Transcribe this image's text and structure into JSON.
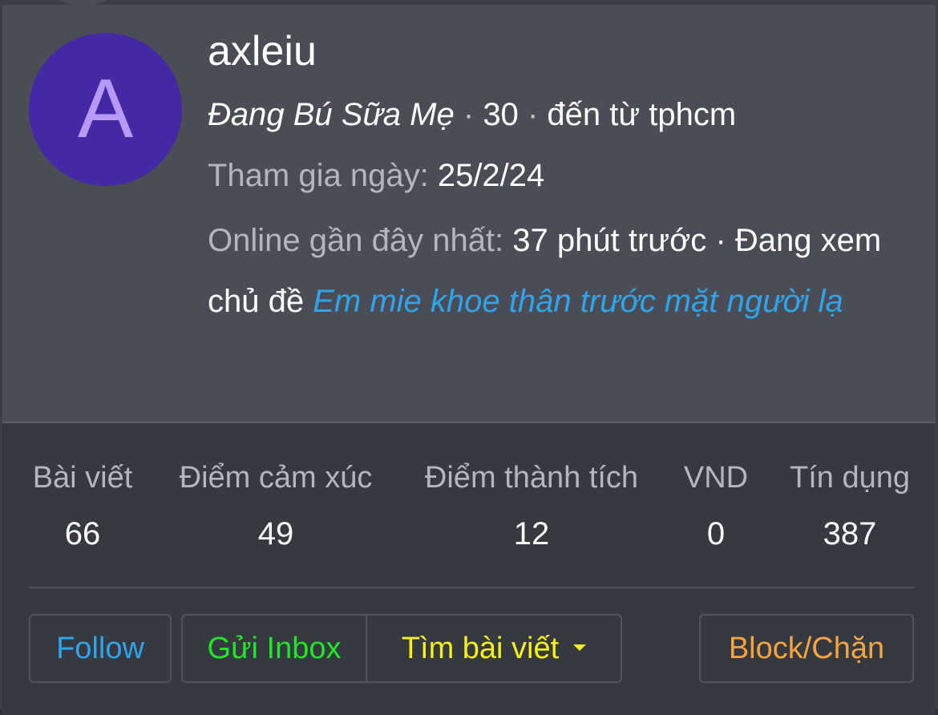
{
  "profile": {
    "avatar_letter": "A",
    "username": "axleiu",
    "user_title": "Đang Bú Sữa Mẹ",
    "age": "30",
    "location_text": "đến từ tphcm",
    "joined_label": "Tham gia ngày:",
    "joined_value": "25/2/24",
    "online_label": "Online gần đây nhất:",
    "online_time": "37 phút trước",
    "activity_text": "Đang xem chủ đề",
    "activity_link": "Em mie khoe thân trước mặt người lạ",
    "separator": "·"
  },
  "stats": [
    {
      "label": "Bài viết",
      "value": "66"
    },
    {
      "label": "Điểm cảm xúc",
      "value": "49"
    },
    {
      "label": "Điểm thành tích",
      "value": "12"
    },
    {
      "label": "VND",
      "value": "0"
    },
    {
      "label": "Tín dụng",
      "value": "387"
    }
  ],
  "actions": {
    "follow": "Follow",
    "inbox": "Gửi Inbox",
    "find_posts": "Tìm bài viết",
    "block": "Block/Chặn"
  },
  "colors": {
    "avatar_bg": "#4528a6",
    "avatar_letter": "#b69af5",
    "link": "#2ea4ec",
    "follow": "#2ea4ec",
    "inbox": "#1fe627",
    "find": "#f4f21a",
    "block": "#f5a442"
  }
}
